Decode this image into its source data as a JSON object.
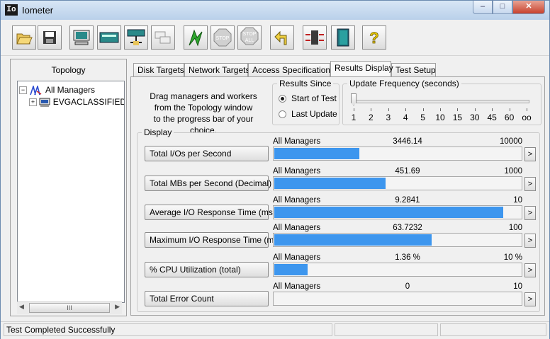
{
  "window": {
    "title": "Iometer",
    "app_icon": "Io"
  },
  "toolbar": {
    "buttons": [
      {
        "name": "open-config-icon"
      },
      {
        "name": "save-config-icon"
      },
      {
        "name": "start-new-manager-icon"
      },
      {
        "name": "start-new-disk-worker-icon"
      },
      {
        "name": "start-new-network-worker-icon"
      },
      {
        "name": "duplicate-worker-icon"
      },
      {
        "name": "start-tests-icon"
      },
      {
        "name": "stop-test-icon"
      },
      {
        "name": "stop-all-icon"
      },
      {
        "name": "reset-workers-icon"
      },
      {
        "name": "exit-icon"
      },
      {
        "name": "exit-door-icon"
      },
      {
        "name": "help-icon"
      }
    ],
    "stop_label": "STOP",
    "stop_all_label": "STOP",
    "stop_all_sub": "ALL",
    "help_label": "?"
  },
  "topology": {
    "title": "Topology",
    "root": "All Managers",
    "child": "EVGACLASSIFIED",
    "scroll_grip": "III"
  },
  "tabs": [
    "Disk Targets",
    "Network Targets",
    "Access Specifications",
    "Results Display",
    "Test Setup"
  ],
  "active_tab": "Results Display",
  "instructions": [
    "Drag managers and workers",
    "from the Topology window",
    "to the progress bar of your choice."
  ],
  "results_since": {
    "label": "Results Since",
    "options": [
      "Start of Test",
      "Last Update"
    ],
    "selected": "Start of Test"
  },
  "update_frequency": {
    "label": "Update Frequency (seconds)",
    "ticks": [
      "1",
      "2",
      "3",
      "4",
      "5",
      "10",
      "15",
      "30",
      "45",
      "60",
      "oo"
    ],
    "selected": "1"
  },
  "display": {
    "label": "Display",
    "metrics": [
      {
        "name": "Total I/Os per Second",
        "source": "All Managers",
        "value": "3446.14",
        "max": "10000",
        "fraction": 0.3446
      },
      {
        "name": "Total MBs per Second (Decimal)",
        "source": "All Managers",
        "value": "451.69",
        "max": "1000",
        "fraction": 0.4517
      },
      {
        "name": "Average I/O Response Time (ms)",
        "source": "All Managers",
        "value": "9.2841",
        "max": "10",
        "fraction": 0.9284
      },
      {
        "name": "Maximum I/O Response Time (ms)",
        "source": "All Managers",
        "value": "63.7232",
        "max": "100",
        "fraction": 0.6372
      },
      {
        "name": "% CPU Utilization (total)",
        "source": "All Managers",
        "value": "1.36 %",
        "max": "10 %",
        "fraction": 0.136
      },
      {
        "name": "Total Error Count",
        "source": "All Managers",
        "value": "0",
        "max": "10",
        "fraction": 0
      }
    ],
    "arrow": ">"
  },
  "status": {
    "text": "Test Completed Successfully"
  },
  "colors": {
    "bar": "#3d96ee",
    "title_bg": "#c9dcf0"
  }
}
